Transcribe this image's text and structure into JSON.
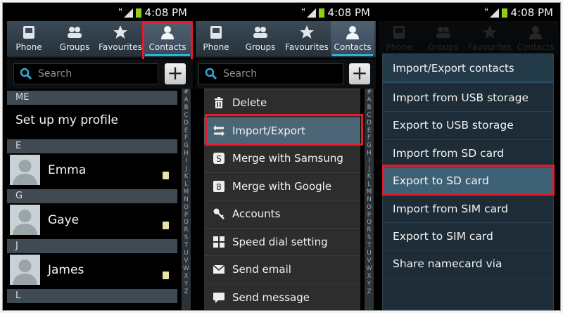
{
  "status": {
    "time": "4:08 PM",
    "signal_label": "H"
  },
  "tabs": [
    {
      "label": "Phone",
      "icon": "phone-icon"
    },
    {
      "label": "Groups",
      "icon": "groups-icon"
    },
    {
      "label": "Favourites",
      "icon": "star-icon"
    },
    {
      "label": "Contacts",
      "icon": "person-icon"
    }
  ],
  "panel1": {
    "search_placeholder": "Search",
    "me_header": "ME",
    "profile_label": "Set up my profile",
    "contacts": [
      {
        "header": "E",
        "name": "Emma"
      },
      {
        "header": "G",
        "name": "Gaye"
      },
      {
        "header": "J",
        "name": "James"
      },
      {
        "header": "L"
      }
    ]
  },
  "index_letters": [
    "#",
    "A",
    "B",
    "C",
    "D",
    "E",
    "F",
    "G",
    "H",
    "I",
    "J",
    "K",
    "L",
    "M",
    "N",
    "O",
    "P",
    "Q",
    "R",
    "S",
    "T",
    "U",
    "V",
    "W",
    "X",
    "Y",
    "Z"
  ],
  "panel2": {
    "search_placeholder": "Search",
    "menu": [
      {
        "label": "Delete",
        "icon": "trash-icon"
      },
      {
        "label": "Import/Export",
        "icon": "import-export-icon"
      },
      {
        "label": "Merge with Samsung",
        "icon": "samsung-icon"
      },
      {
        "label": "Merge with Google",
        "icon": "google-icon"
      },
      {
        "label": "Accounts",
        "icon": "key-icon"
      },
      {
        "label": "Speed dial setting",
        "icon": "speed-dial-icon"
      },
      {
        "label": "Send email",
        "icon": "email-icon"
      },
      {
        "label": "Send message",
        "icon": "message-icon"
      }
    ]
  },
  "panel3": {
    "title": "Import/Export contacts",
    "options": [
      "Import from USB storage",
      "Export to USB storage",
      "Import from SD card",
      "Export to SD card",
      "Import from SIM card",
      "Export to SIM card",
      "Share namecard via"
    ]
  },
  "colors": {
    "highlight_box": "#e51a2a",
    "tab_accent": "#28b7d6",
    "battery": "#8fd10f"
  }
}
